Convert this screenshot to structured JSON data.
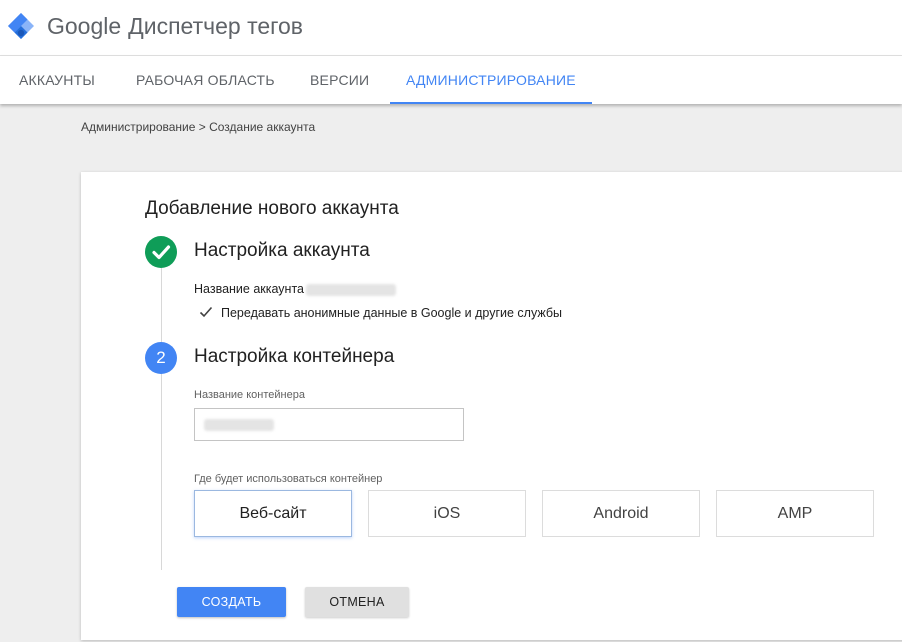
{
  "header": {
    "brand_google": "Google",
    "brand_product": "Диспетчер тегов",
    "logo_icon": "tag-manager-diamond-icon",
    "accent_color": "#4285f4"
  },
  "tabs": [
    {
      "label": "Аккаунты",
      "active": false
    },
    {
      "label": "Рабочая область",
      "active": false
    },
    {
      "label": "Версии",
      "active": false
    },
    {
      "label": "Администрирование",
      "active": true
    }
  ],
  "breadcrumb": "Администрирование > Создание аккаунта",
  "card": {
    "title": "Добавление нового аккаунта",
    "step1": {
      "icon": "check-icon",
      "status_color": "#0f9d58",
      "title": "Настройка аккаунта",
      "account_name_label": "Название аккаунта",
      "share_data_text": "Передавать анонимные данные в Google и другие службы"
    },
    "step2": {
      "number": "2",
      "title": "Настройка контейнера",
      "container_name_label": "Название контейнера",
      "usage_label": "Где будет использоваться контейнер",
      "platforms": [
        {
          "label": "Веб-сайт",
          "selected": true
        },
        {
          "label": "iOS",
          "selected": false
        },
        {
          "label": "Android",
          "selected": false
        },
        {
          "label": "AMP",
          "selected": false
        }
      ]
    },
    "buttons": {
      "create": "Создать",
      "cancel": "Отмена"
    }
  }
}
